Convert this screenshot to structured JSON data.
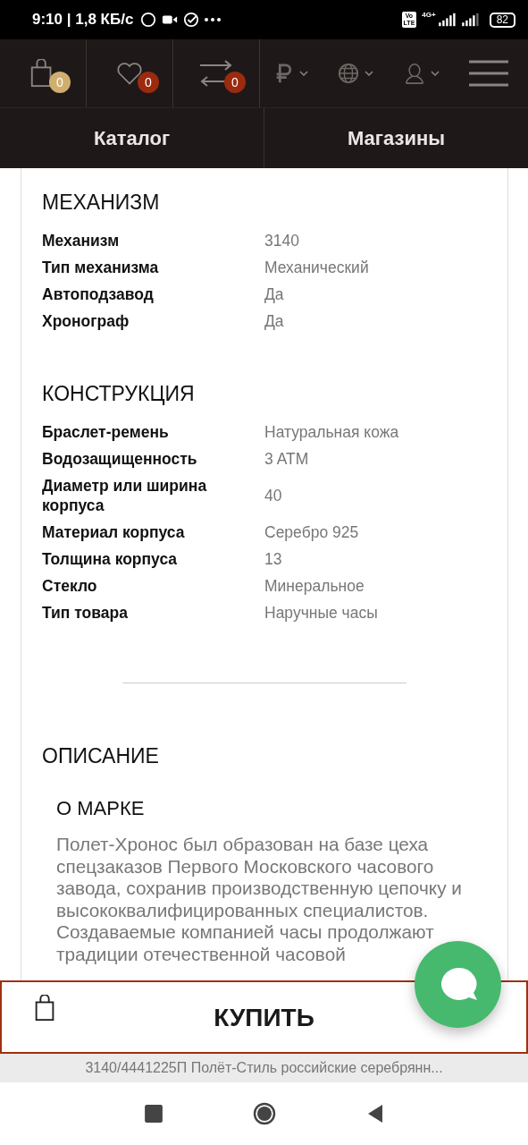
{
  "status_bar": {
    "time": "9:10 | 1,8 КБ/с",
    "volte_top": "Vo",
    "volte_bottom": "LTE",
    "network": "4G+",
    "battery": "82"
  },
  "header": {
    "cart_count": "0",
    "favorites_count": "0",
    "compare_count": "0"
  },
  "nav_links": [
    {
      "label": "Каталог"
    },
    {
      "label": "Магазины"
    }
  ],
  "sections": [
    {
      "title": "МЕХАНИЗМ",
      "rows": [
        {
          "label": "Механизм",
          "value": "3140"
        },
        {
          "label": "Тип механизма",
          "value": "Механический"
        },
        {
          "label": "Автоподзавод",
          "value": "Да"
        },
        {
          "label": "Хронограф",
          "value": "Да"
        }
      ]
    },
    {
      "title": "КОНСТРУКЦИЯ",
      "rows": [
        {
          "label": "Браслет-ремень",
          "value": "Натуральная кожа"
        },
        {
          "label": "Водозащищенность",
          "value": "3 ATM"
        },
        {
          "label": "Диаметр или ширина корпуса",
          "value": "40"
        },
        {
          "label": "Материал корпуса",
          "value": "Серебро 925"
        },
        {
          "label": "Толщина корпуса",
          "value": "13"
        },
        {
          "label": "Стекло",
          "value": "Минеральное"
        },
        {
          "label": "Тип товара",
          "value": "Наручные часы"
        }
      ]
    }
  ],
  "description": {
    "title": "ОПИСАНИЕ",
    "subtitle": "О МАРКЕ",
    "text": "Полет-Хронос был образован на базе цеха спецзаказов Первого Московского часового завода, сохранив производственную цепочку и высококвалифицированных специалистов. Создаваемые компанией часы продолжают традиции отечественной часовой"
  },
  "buy_button": {
    "label": "КУПИТЬ"
  },
  "page_caption": "3140/4441225П Полёт-Стиль российские серебрянн..."
}
